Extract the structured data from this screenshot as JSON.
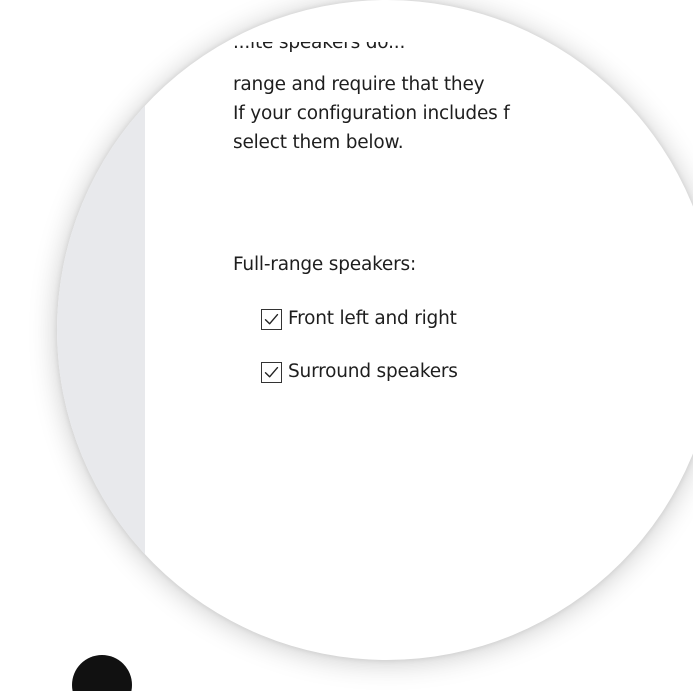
{
  "dialog": {
    "description_lines": [
      "...ite speakers do...",
      "range and require that they",
      "If your configuration includes f",
      "select them below."
    ],
    "full_range_heading": "Full-range speakers:",
    "options": [
      {
        "label": "Front left and right",
        "checked": true
      },
      {
        "label": "Surround speakers",
        "checked": true
      }
    ]
  },
  "colors": {
    "side_panel": "#e8e9ec",
    "text": "#1e1e1e",
    "checkbox_border": "#333333"
  }
}
